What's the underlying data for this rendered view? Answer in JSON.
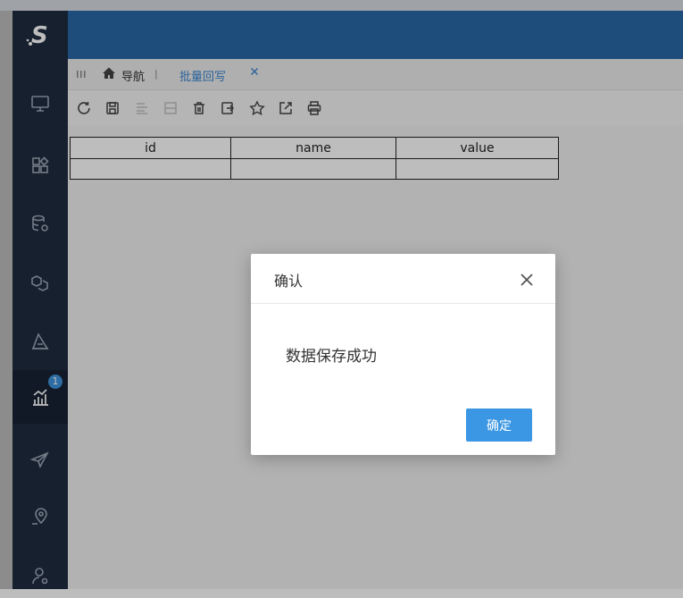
{
  "tabs": {
    "home_label": "导航",
    "separator": "|",
    "active_label": "批量回写",
    "close_symbol": "×"
  },
  "sidebar": {
    "badge_count": "1",
    "items": [
      {
        "icon": "monitor-icon"
      },
      {
        "icon": "apps-grid-icon"
      },
      {
        "icon": "database-settings-icon"
      },
      {
        "icon": "cubes-icon"
      },
      {
        "icon": "triangle-ruler-icon"
      },
      {
        "icon": "bar-chart-icon"
      },
      {
        "icon": "paper-plane-icon"
      },
      {
        "icon": "location-pin-icon"
      },
      {
        "icon": "user-settings-icon"
      }
    ]
  },
  "toolbar": {
    "tools": [
      "refresh-icon",
      "save-icon",
      "insert-row-icon",
      "append-row-icon",
      "delete-icon",
      "import-icon",
      "favorite-icon",
      "export-icon",
      "print-icon"
    ]
  },
  "grid": {
    "columns": [
      "id",
      "name",
      "value"
    ]
  },
  "dialog": {
    "title": "确认",
    "message": "数据保存成功",
    "ok_label": "确定"
  },
  "colors": {
    "header": "#2a68a7",
    "sidebar": "#1f2c3f",
    "accent": "#3b97e3",
    "tab_active": "#3a86d1"
  }
}
